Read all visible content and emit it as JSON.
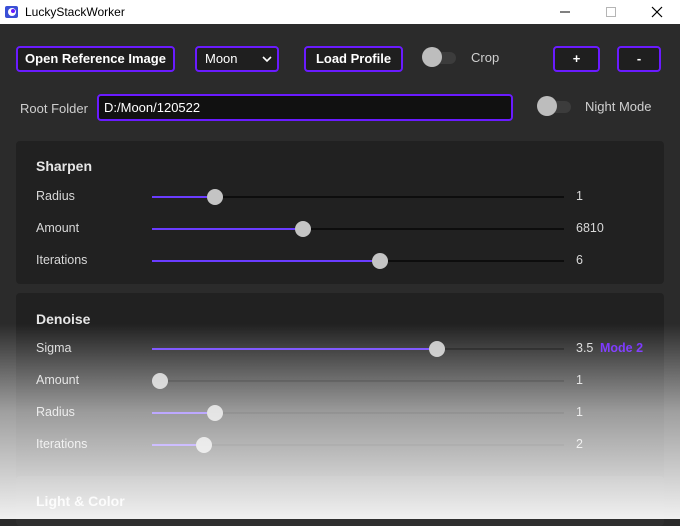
{
  "window": {
    "title": "LuckyStackWorker",
    "icon": "app-icon",
    "controls": {
      "minimize": "minimize-icon",
      "maximize": "maximize-icon",
      "close": "close-icon"
    }
  },
  "toolbar": {
    "open_reference_label": "Open Reference Image",
    "profile_select_value": "Moon",
    "load_profile_label": "Load Profile",
    "crop_label": "Crop",
    "crop_enabled": false,
    "plus_label": "+",
    "minus_label": "-"
  },
  "root": {
    "label": "Root Folder",
    "value": "D:/Moon/120522",
    "night_mode_label": "Night Mode",
    "night_mode_enabled": false
  },
  "sharpen": {
    "title": "Sharpen",
    "rows": [
      {
        "label": "Radius",
        "value": "1",
        "fraction": 0.14
      },
      {
        "label": "Amount",
        "value": "6810",
        "fraction": 0.36
      },
      {
        "label": "Iterations",
        "value": "6",
        "fraction": 0.555
      }
    ]
  },
  "denoise": {
    "title": "Denoise",
    "rows": [
      {
        "label": "Sigma",
        "value": "3.5",
        "fraction": 0.7,
        "badge": "Mode 2"
      },
      {
        "label": "Amount",
        "value": "1",
        "fraction": 0.0
      },
      {
        "label": "Radius",
        "value": "1",
        "fraction": 0.14
      },
      {
        "label": "Iterations",
        "value": "2",
        "fraction": 0.11
      }
    ]
  },
  "light_color": {
    "title": "Light & Color"
  },
  "colors": {
    "accent": "#6a1bff",
    "slider_fill": "#6a3cff",
    "panel": "#212121",
    "background": "#2b2b2b"
  }
}
